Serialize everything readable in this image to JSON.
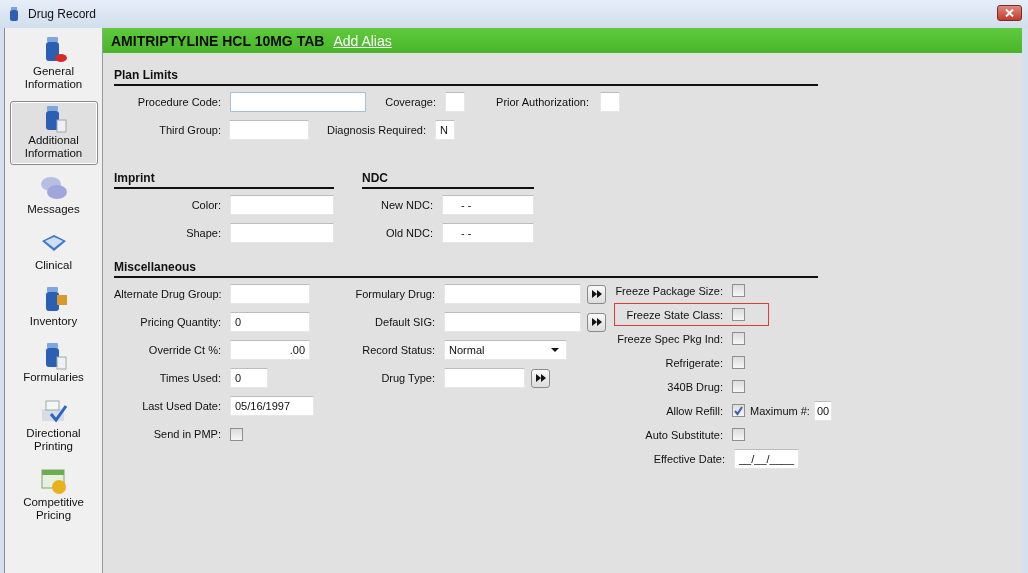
{
  "window": {
    "title": "Drug Record"
  },
  "sidebar": {
    "items": [
      {
        "label": "General Information",
        "selected": false
      },
      {
        "label": "Additional Information",
        "selected": true
      },
      {
        "label": "Messages",
        "selected": false
      },
      {
        "label": "Clinical",
        "selected": false
      },
      {
        "label": "Inventory",
        "selected": false
      },
      {
        "label": "Formularies",
        "selected": false
      },
      {
        "label": "Directional Printing",
        "selected": false
      },
      {
        "label": "Competitive Pricing",
        "selected": false
      }
    ]
  },
  "header": {
    "title": "AMITRIPTYLINE HCL 10MG TAB",
    "link": "Add Alias"
  },
  "plan_limits": {
    "title": "Plan Limits",
    "fields": [
      {
        "label": "Procedure Code:"
      },
      {
        "label": "Coverage:"
      },
      {
        "label": "Prior Authorization:"
      },
      {
        "label": "Third Group:"
      },
      {
        "label": "Diagnosis Required:",
        "value": "N"
      }
    ]
  },
  "imprint": {
    "title": "Imprint",
    "fields": [
      {
        "label": "Color:"
      },
      {
        "label": "Shape:"
      }
    ]
  },
  "ndc": {
    "title": "NDC",
    "fields": [
      {
        "label": "New NDC:",
        "value": "-   -"
      },
      {
        "label": "Old NDC:",
        "value": "-   -"
      }
    ]
  },
  "miscellaneous": {
    "title": "Miscellaneous",
    "column_1": [
      {
        "kind": "text",
        "label": "Alternate Drug Group:"
      },
      {
        "kind": "text",
        "label": "Pricing Quantity:",
        "value": "0"
      },
      {
        "kind": "number",
        "label": "Override Ct %:",
        "value": ".00"
      },
      {
        "kind": "text",
        "label": "Times Used:",
        "value": "0"
      },
      {
        "kind": "text",
        "label": "Last Used Date:",
        "value": "05/16/1997"
      },
      {
        "kind": "checkbox",
        "label": "Send in PMP:",
        "checked": false
      }
    ],
    "column_2": [
      {
        "kind": "lookup",
        "label": "Formulary Drug:"
      },
      {
        "kind": "lookup",
        "label": "Default SIG:"
      },
      {
        "kind": "select",
        "label": "Record Status:",
        "value": "Normal"
      },
      {
        "kind": "lookup",
        "label": "Drug Type:"
      }
    ],
    "column_3": [
      {
        "kind": "checkbox",
        "label": "Freeze Package Size:",
        "checked": false,
        "highlighted": false
      },
      {
        "kind": "checkbox",
        "label": "Freeze State Class:",
        "checked": false,
        "highlighted": true
      },
      {
        "kind": "checkbox",
        "label": "Freeze Spec Pkg Ind:",
        "checked": false,
        "highlighted": false
      },
      {
        "kind": "checkbox",
        "label": "Refrigerate:",
        "checked": false,
        "highlighted": false
      },
      {
        "kind": "checkbox",
        "label": "340B Drug:",
        "checked": false,
        "highlighted": false
      },
      {
        "kind": "refill",
        "label": "Allow Refill:",
        "checked": true,
        "highlighted": false,
        "extra_label": "Maximum #:",
        "extra_value": "00"
      },
      {
        "kind": "checkbox",
        "label": "Auto Substitute:",
        "checked": false,
        "highlighted": false
      },
      {
        "kind": "date",
        "label": "Effective Date:",
        "value": "__/__/____",
        "highlighted": false
      }
    ]
  }
}
